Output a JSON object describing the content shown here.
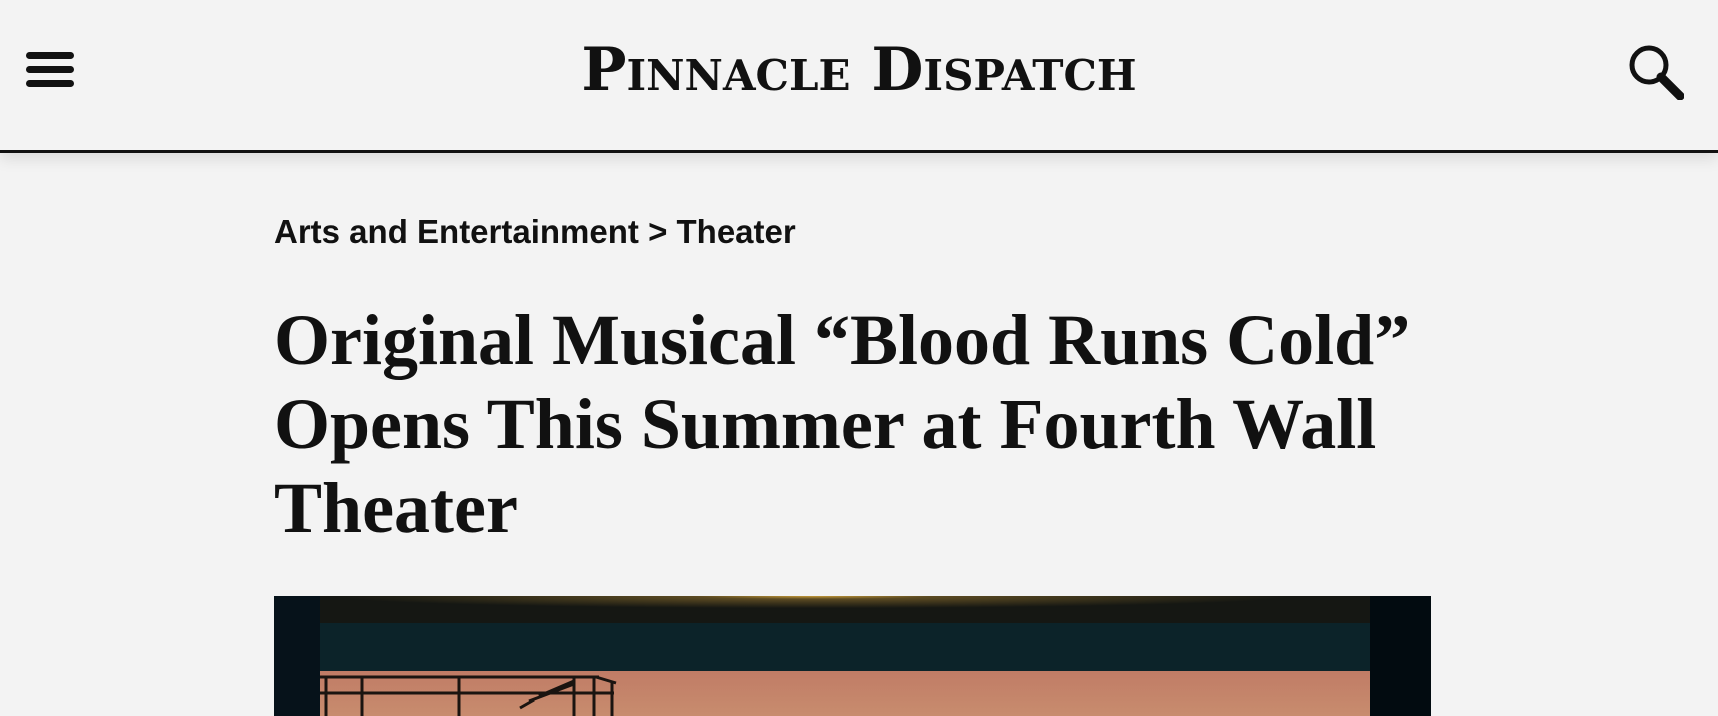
{
  "header": {
    "menu_icon": "hamburger-menu-icon",
    "logo": "Pinnacle Dispatch",
    "search_icon": "magnifier-icon"
  },
  "breadcrumb": {
    "section": "Arts and Entertainment",
    "separator": ">",
    "subsection": "Theater"
  },
  "article": {
    "headline": "Original Musical “Blood Runs Cold” Opens This Summer at Fourth Wall Theater"
  },
  "colors": {
    "background": "#f3f3f3",
    "text": "#111111",
    "hero_frame": "#06121a",
    "hero_sky": "#c2826a"
  }
}
